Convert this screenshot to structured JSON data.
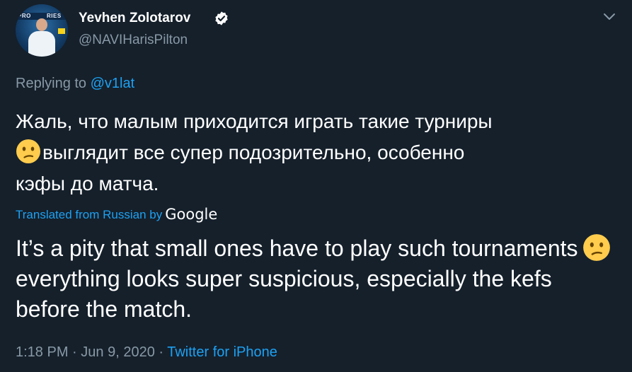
{
  "author": {
    "display_name": "Yevhen Zolotarov",
    "handle": "@NAVIHarisPilton",
    "verified": true,
    "avatar_banner_text": [
      "PRO",
      "RIES"
    ]
  },
  "reply": {
    "prefix": "Replying to",
    "mention": "@v1lat"
  },
  "tweet": {
    "original_line_1": "Жаль, что малым приходится играть такие турниры",
    "original_line_2": "выглядит все супер подозрительно, особенно",
    "original_line_3": "кэфы до матча.",
    "original_emoji": "confused-face-emoji",
    "translated_label": "Translated from Russian by",
    "translator": "Google",
    "translation_part_1": "It’s a pity that small ones have to play such tournaments",
    "translation_part_2": "everything looks super suspicious, especially the kefs before the match.",
    "translation_emoji": "confused-face-emoji"
  },
  "meta": {
    "time": "1:18 PM",
    "separator": "·",
    "date": "Jun 9, 2020",
    "source": "Twitter for iPhone"
  },
  "icons": {
    "verified": "verified-badge-icon",
    "menu": "chevron-down-icon"
  },
  "colors": {
    "background": "#15202b",
    "primary_text": "#ffffff",
    "secondary_text": "#8899a6",
    "accent": "#1da1f2",
    "emoji_yellow": "#ffcc4d"
  }
}
